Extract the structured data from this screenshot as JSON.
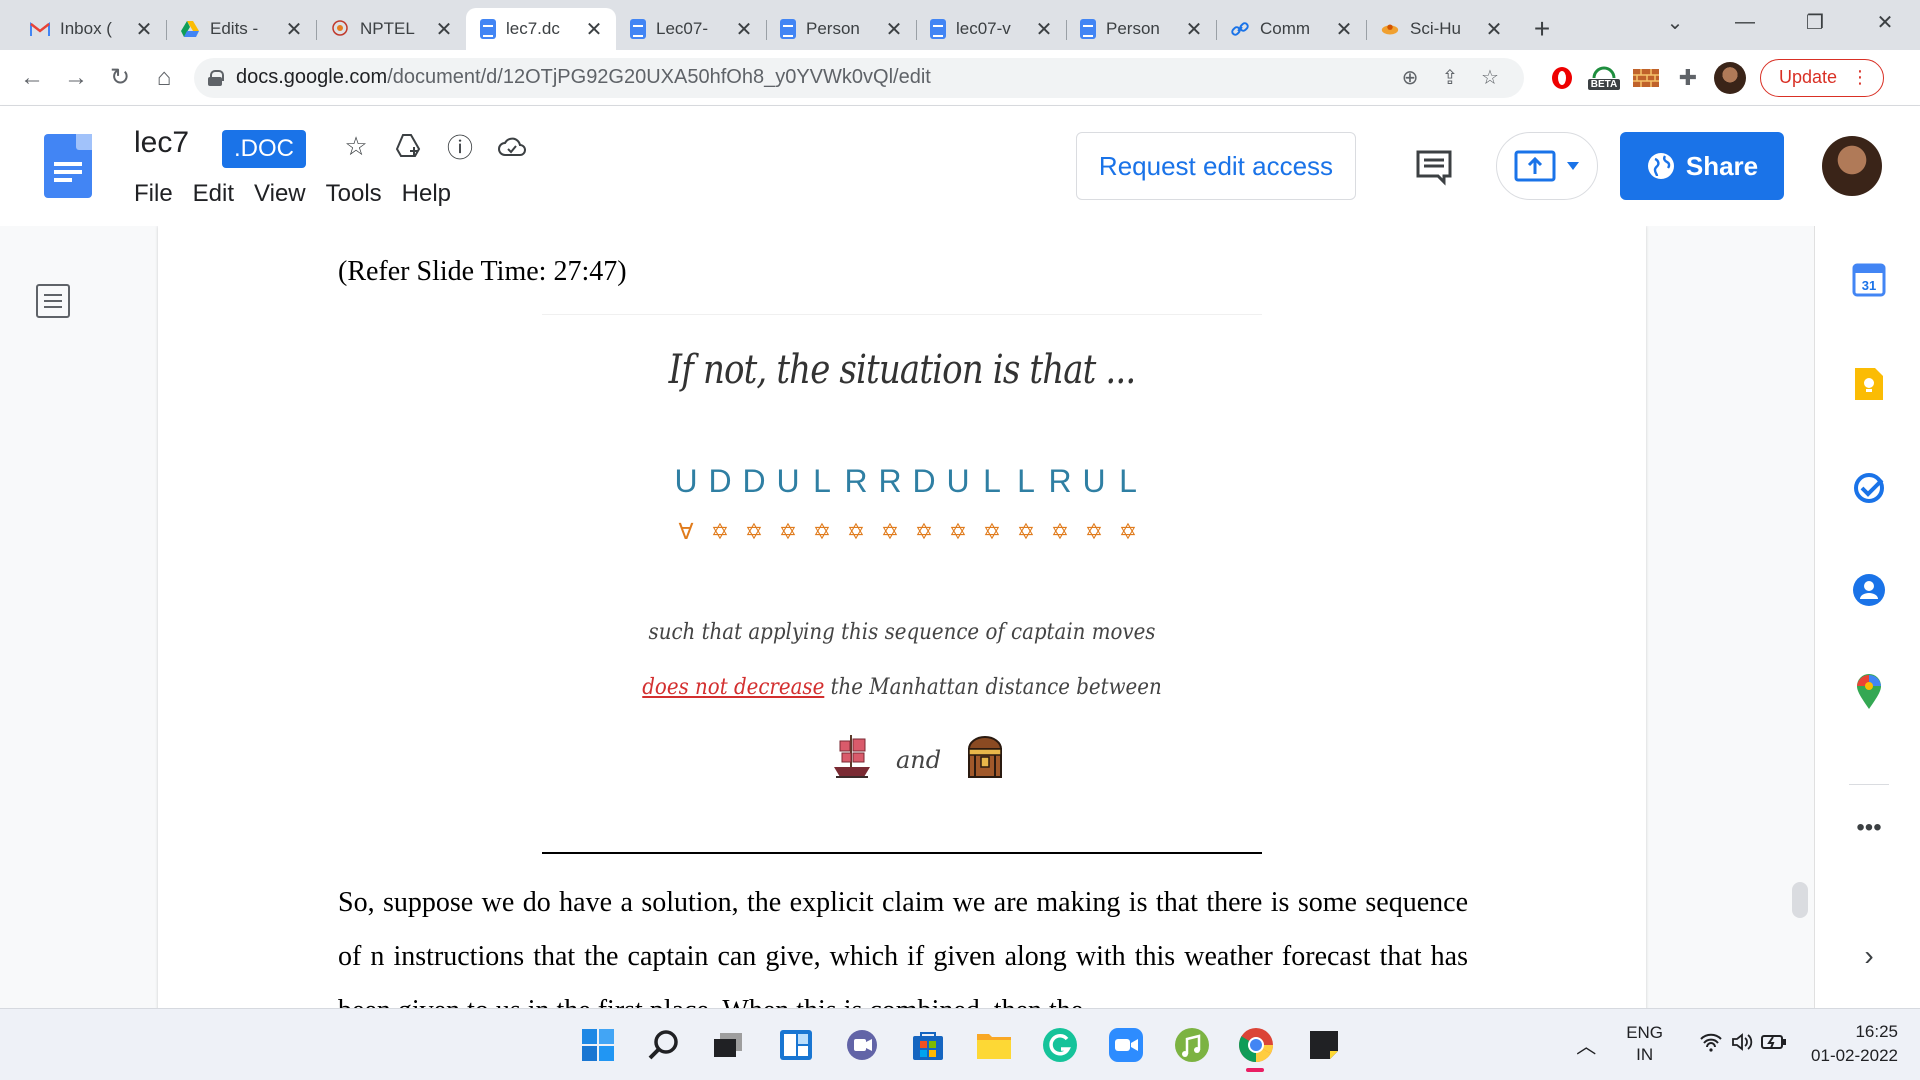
{
  "browser": {
    "tabs": [
      {
        "label": "Inbox (",
        "icon": "gmail-icon",
        "active": false
      },
      {
        "label": "Edits -",
        "icon": "drive-icon",
        "active": false
      },
      {
        "label": "NPTEL",
        "icon": "nptel-icon",
        "active": false
      },
      {
        "label": "lec7.dc",
        "icon": "docs-icon",
        "active": true
      },
      {
        "label": "Lec07-",
        "icon": "docs-icon",
        "active": false
      },
      {
        "label": "Person",
        "icon": "docs-icon",
        "active": false
      },
      {
        "label": "lec07-v",
        "icon": "docs-icon",
        "active": false
      },
      {
        "label": "Person",
        "icon": "docs-icon",
        "active": false
      },
      {
        "label": "Comm",
        "icon": "link-icon",
        "active": false
      },
      {
        "label": "Sci-Hu",
        "icon": "scihub-icon",
        "active": false
      }
    ],
    "url_host": "docs.google.com",
    "url_path": "/document/d/12OTjPG92G20UXA50hfOh8_y0YVWk0vQl/edit",
    "update_label": "Update",
    "beta_badge": "BETA"
  },
  "docs": {
    "title": "lec7",
    "badge": ".DOC",
    "menu": [
      "File",
      "Edit",
      "View",
      "Tools",
      "Help"
    ],
    "request_edit": "Request edit access",
    "share": "Share",
    "accent": "#1a73e8"
  },
  "document": {
    "ref_slide": "(Refer Slide Time: 27:47)",
    "slide": {
      "title": "If not, the situation is that ...",
      "moves": [
        "U",
        "D",
        "D",
        "U",
        "L",
        "R",
        "R",
        "D",
        "U",
        "L",
        "L",
        "R",
        "U",
        "L"
      ],
      "line1": "such that applying this sequence of captain moves",
      "line2_red": "does not decrease",
      "line2_rest": " the Manhattan distance between",
      "and": "and"
    },
    "body": "So, suppose we do have a solution, the explicit claim we are making is that there is some sequence of n instructions that the captain can give, which if given along with this weather forecast that has been given to us in the first place. When this is combined, then the"
  },
  "side_calendar_day": "31",
  "taskbar": {
    "lang_top": "ENG",
    "lang_bottom": "IN",
    "time": "16:25",
    "date": "01-02-2022"
  }
}
